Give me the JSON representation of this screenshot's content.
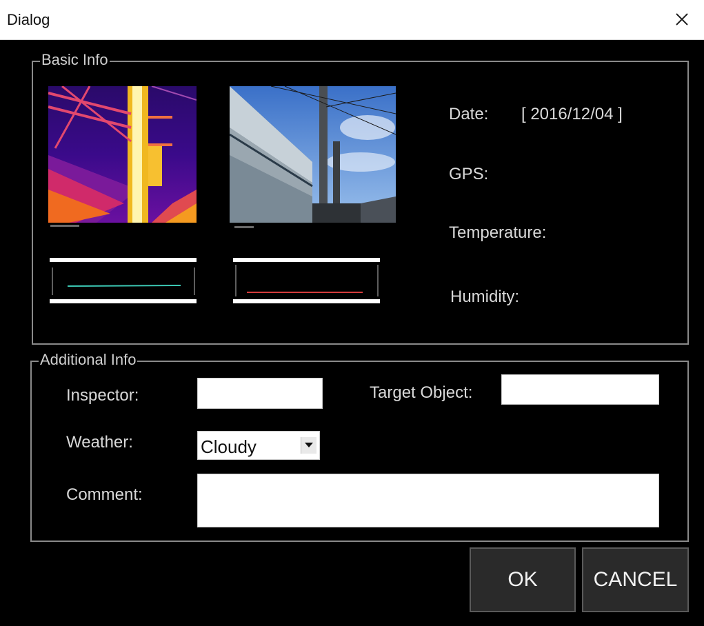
{
  "window": {
    "title": "Dialog"
  },
  "basic_info": {
    "legend": "Basic Info",
    "date_label": "Date:",
    "date_value": "[ 2016/12/04 ]",
    "gps_label": "GPS:",
    "temperature_label": "Temperature:",
    "humidity_label": "Humidity:"
  },
  "additional_info": {
    "legend": "Additional Info",
    "inspector_label": "Inspector:",
    "inspector_value": "",
    "target_object_label": "Target Object:",
    "target_object_value": "",
    "weather_label": "Weather:",
    "weather_selected": "Cloudy",
    "comment_label": "Comment:",
    "comment_value": ""
  },
  "buttons": {
    "ok": "OK",
    "cancel": "CANCEL"
  },
  "icons": {
    "close": "close-icon",
    "dropdown": "chevron-down-icon"
  },
  "colors": {
    "background": "#000000",
    "title_bar": "#ffffff",
    "frame": "#8a8a8a",
    "text": "#d8d8d8",
    "button": "#2a2a2a",
    "thermal_trace": "#3cc8b4",
    "visible_trace": "#d43c3c"
  }
}
